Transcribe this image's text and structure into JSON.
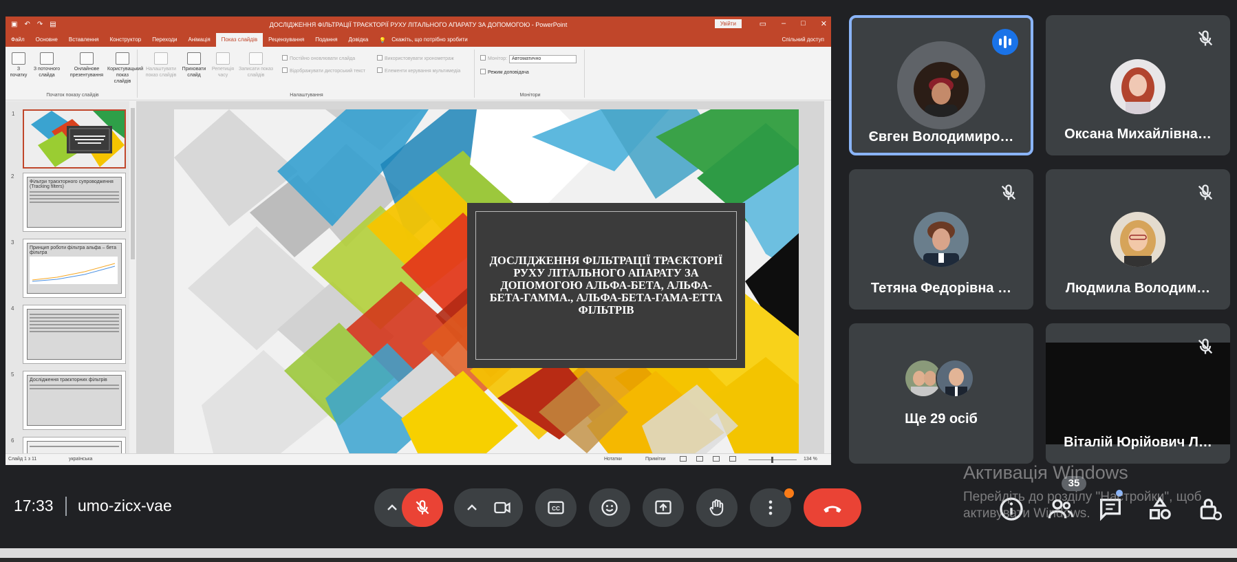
{
  "powerpoint": {
    "window_title": "ДОСЛІДЖЕННЯ ФІЛЬТРАЦІЇ ТРАЄКТОРІЇ РУХУ ЛІТАЛЬНОГО АПАРАТУ ЗА ДОПОМОГОЮ - PowerPoint",
    "signin_label": "Увійти",
    "tabs": [
      "Файл",
      "Основне",
      "Вставлення",
      "Конструктор",
      "Переходи",
      "Анімація",
      "Показ слайдів",
      "Рецензування",
      "Подання",
      "Довідка"
    ],
    "active_tab": "Показ слайдів",
    "tell_me": "Скажіть, що потрібно зробити",
    "share": "Спільний доступ",
    "ribbon": {
      "btn_from_beginning": "З початку",
      "btn_from_current": "З поточного слайда",
      "btn_online": "Онлайнове презентування",
      "btn_custom": "Користувацький показ слайдів",
      "group_start": "Початок показу слайдів",
      "btn_setup": "Налаштувати показ слайдів",
      "btn_hide": "Приховати слайд",
      "btn_rehearse": "Репетиція часу",
      "btn_record": "Записати показ слайдів",
      "chk_update": "Постійно оновлювати слайда",
      "chk_subtitles": "Відображувати дисторський текст",
      "chk_timings": "Використовувати хронометраж",
      "chk_media": "Елементи керування мультимедіа",
      "group_setup": "Налаштування",
      "monitor_label": "Монітор:",
      "monitor_value": "Автоматично",
      "presenter_view": "Режим доповідача",
      "group_monitors": "Монітори"
    },
    "thumbnails": [
      {
        "num": "1",
        "title": ""
      },
      {
        "num": "2",
        "title": "Фільтри траєкторного супроводження (Tracking filters)"
      },
      {
        "num": "3",
        "title": "Принцип роботи фільтра альфа – бета фільтра"
      },
      {
        "num": "4",
        "title": ""
      },
      {
        "num": "5",
        "title": "Дослідження траєкторних фільтрів"
      },
      {
        "num": "6",
        "title": ""
      }
    ],
    "slide_title": "ДОСЛІДЖЕННЯ ФІЛЬТРАЦІЇ ТРАЄКТОРІЇ РУХУ ЛІТАЛЬНОГО АПАРАТУ  ЗА ДОПОМОГОЮ АЛЬФА-БЕТА, АЛЬФА-БЕТА-ГАММА., АЛЬФА-БЕТА-ГАМА-ЕТТА ФІЛЬТРІВ",
    "status": {
      "slide_of": "Слайд 1 з 11",
      "language": "українська",
      "notes": "Нотатки",
      "comments": "Примітки",
      "zoom": "134 %"
    }
  },
  "participants": [
    {
      "name": "Євген Володимиро…",
      "speaking": true
    },
    {
      "name": "Оксана Михайлівна…",
      "muted": true
    },
    {
      "name": "Тетяна Федорівна …",
      "muted": true
    },
    {
      "name": "Людмила Володим…",
      "muted": true
    },
    {
      "name": "Ще 29 осіб"
    },
    {
      "name": "Віталій Юрійович Л…",
      "muted": true
    }
  ],
  "meeting": {
    "time": "17:33",
    "code": "umo-zicx-vae",
    "people_count": "35"
  },
  "watermark": {
    "line1": "Активація Windows",
    "line2": "Перейдіть до розділу \"Настройки\", щоб",
    "line3": "активувати Windows."
  },
  "colors": {
    "ppt_accent": "#c0462a",
    "meet_bg": "#202124",
    "tile_bg": "#3c4043",
    "active_speaker": "#8ab4f8",
    "end_call": "#ea4335"
  }
}
